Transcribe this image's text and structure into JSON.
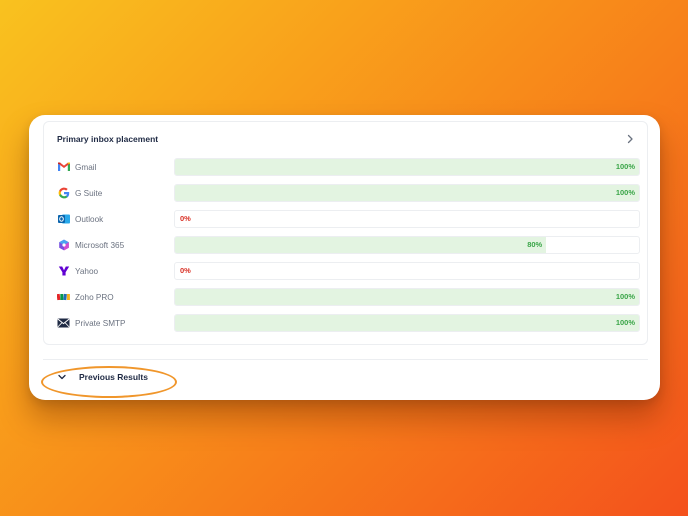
{
  "panel": {
    "title": "Primary inbox placement"
  },
  "providers": [
    {
      "label": "Gmail",
      "icon": "gmail-icon",
      "percent_text": "100%",
      "fraction": 1.0
    },
    {
      "label": "G Suite",
      "icon": "google-icon",
      "percent_text": "100%",
      "fraction": 1.0
    },
    {
      "label": "Outlook",
      "icon": "outlook-icon",
      "percent_text": "0%",
      "fraction": 0.0
    },
    {
      "label": "Microsoft 365",
      "icon": "microsoft-365-icon",
      "percent_text": "80%",
      "fraction": 0.8
    },
    {
      "label": "Yahoo",
      "icon": "yahoo-icon",
      "percent_text": "0%",
      "fraction": 0.0
    },
    {
      "label": "Zoho PRO",
      "icon": "zoho-icon",
      "percent_text": "100%",
      "fraction": 1.0
    },
    {
      "label": "Private SMTP",
      "icon": "envelope-icon",
      "percent_text": "100%",
      "fraction": 1.0
    }
  ],
  "footer": {
    "previous_results_label": "Previous Results"
  },
  "colors": {
    "fill_good": "#e3f4e1",
    "text_good": "#3aa548",
    "text_bad": "#d93025",
    "highlight": "#f0962b"
  }
}
